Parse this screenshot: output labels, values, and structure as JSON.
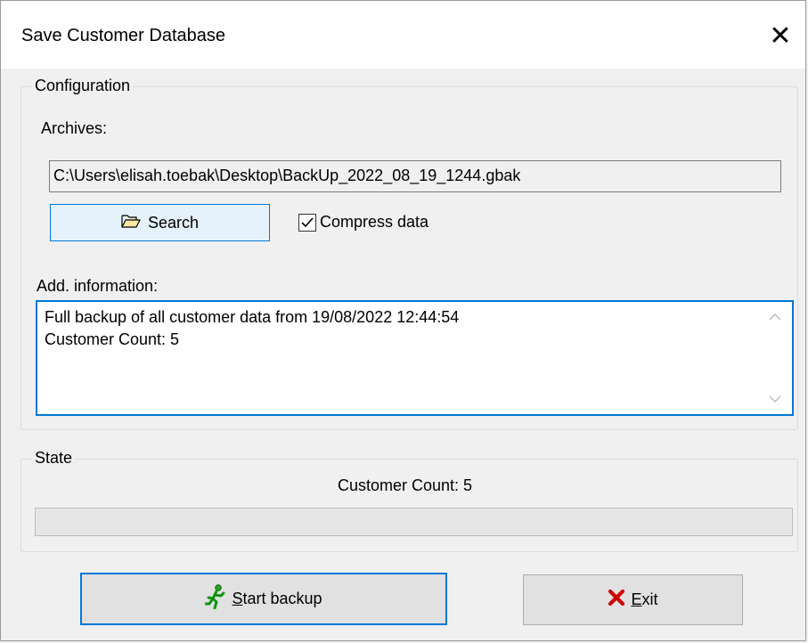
{
  "window": {
    "title": "Save Customer Database",
    "close_glyph": "✕"
  },
  "configuration": {
    "group_label": "Configuration",
    "archives_label": "Archives:",
    "archive_path": "C:\\Users\\elisah.toebak\\Desktop\\BackUp_2022_08_19_1244.gbak",
    "search_button_label": "Search",
    "search_icon": "folder-open-icon",
    "compress_label": "Compress data",
    "compress_checked": true,
    "add_info_label": "Add. information:",
    "add_info_lines": [
      "Full backup of all customer data from 19/08/2022 12:44:54",
      "Customer Count: 5"
    ]
  },
  "state": {
    "group_label": "State",
    "status_text": "Customer Count: 5",
    "progress_fraction": 0
  },
  "actions": {
    "start_label_accel": "S",
    "start_label_rest": "tart backup",
    "start_icon": "running-man-icon",
    "exit_label_accel": "E",
    "exit_label_rest": "xit",
    "exit_icon": "red-x-icon"
  },
  "colors": {
    "accent": "#0078d7",
    "exit_icon": "#cc0000",
    "start_icon": "#1fae1f"
  }
}
